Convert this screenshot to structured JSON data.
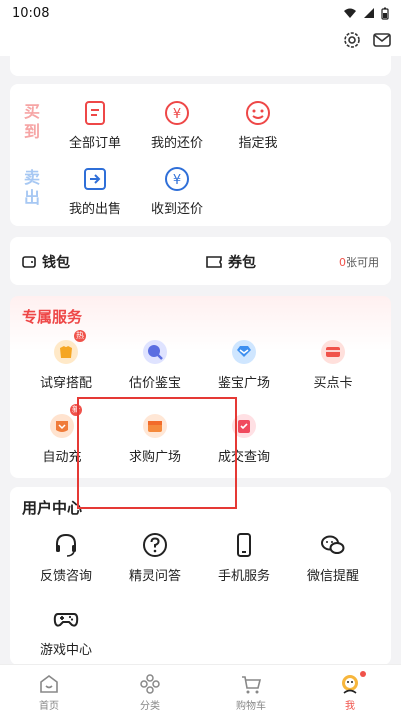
{
  "status_bar": {
    "time": "10:08"
  },
  "header": {
    "settings_icon": "gear-icon",
    "message_icon": "mail-icon"
  },
  "buy_sell": {
    "buy_label": "买到",
    "sell_label": "卖出",
    "buy_items": [
      {
        "label": "全部订单",
        "icon": "order-list-icon"
      },
      {
        "label": "我的还价",
        "icon": "yuan-icon"
      },
      {
        "label": "指定我",
        "icon": "smile-icon"
      }
    ],
    "sell_items": [
      {
        "label": "我的出售",
        "icon": "sell-arrow-icon"
      },
      {
        "label": "收到还价",
        "icon": "yuan-icon"
      }
    ]
  },
  "wallet": {
    "wallet_label": "钱包",
    "coupon_label": "券包",
    "coupon_count": "0",
    "coupon_suffix": "张可用"
  },
  "services": {
    "title": "专属服务",
    "items": [
      {
        "label": "试穿搭配",
        "icon": "try-on-icon",
        "badge": "热"
      },
      {
        "label": "估价鉴宝",
        "icon": "appraise-icon",
        "badge": ""
      },
      {
        "label": "鉴宝广场",
        "icon": "appraise-square-icon",
        "badge": ""
      },
      {
        "label": "买点卡",
        "icon": "card-icon",
        "badge": ""
      },
      {
        "label": "自动充",
        "icon": "auto-recharge-icon",
        "badge": "新"
      },
      {
        "label": "求购广场",
        "icon": "want-buy-icon",
        "badge": ""
      },
      {
        "label": "成交查询",
        "icon": "deal-query-icon",
        "badge": ""
      }
    ]
  },
  "user_center": {
    "title": "用户中心",
    "items": [
      {
        "label": "反馈咨询",
        "icon": "headset-icon"
      },
      {
        "label": "精灵问答",
        "icon": "question-icon"
      },
      {
        "label": "手机服务",
        "icon": "phone-icon"
      },
      {
        "label": "微信提醒",
        "icon": "wechat-icon"
      },
      {
        "label": "游戏中心",
        "icon": "gamepad-icon"
      }
    ]
  },
  "nav": {
    "items": [
      {
        "label": "首页",
        "icon": "home-icon"
      },
      {
        "label": "分类",
        "icon": "category-icon"
      },
      {
        "label": "购物车",
        "icon": "cart-icon"
      },
      {
        "label": "我",
        "icon": "profile-icon"
      }
    ]
  },
  "colors": {
    "accent": "#f0524a",
    "buy": "#f6a5a5",
    "sell": "#a7c8f3",
    "sell_icon": "#2f6fd8"
  }
}
